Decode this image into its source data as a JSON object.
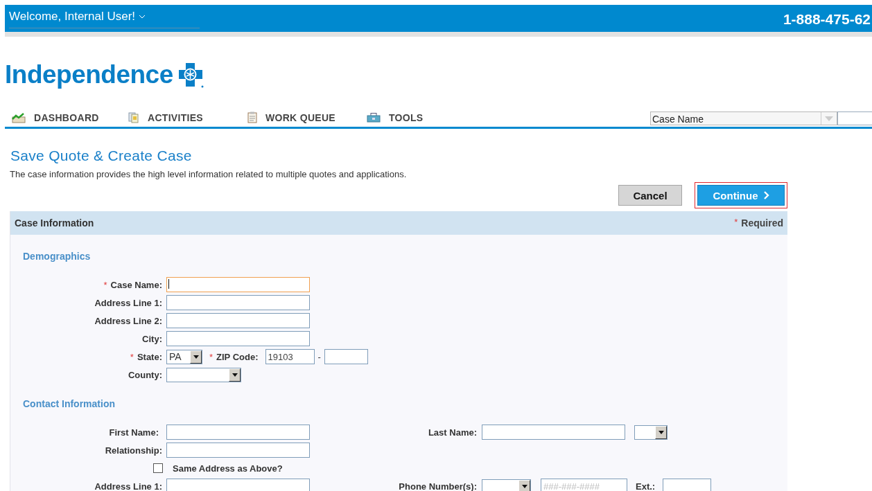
{
  "top_bar": {
    "greeting": "Welcome, Internal User!",
    "phone": "1-888-475-62"
  },
  "logo": {
    "text": "Independence"
  },
  "nav": {
    "items": [
      {
        "label": "DASHBOARD",
        "kind": "chart"
      },
      {
        "label": "ACTIVITIES",
        "kind": "documents"
      },
      {
        "label": "WORK QUEUE",
        "kind": "clipboard"
      },
      {
        "label": "TOOLS",
        "kind": "toolbox"
      }
    ],
    "search_by": "Case Name"
  },
  "page": {
    "title": "Save Quote & Create Case",
    "description": "The case information provides the high level information related to multiple quotes and applications."
  },
  "buttons": [
    {
      "label": "Cancel",
      "kind": "secondary",
      "highlighted": false
    },
    {
      "label": "Continue",
      "kind": "primary",
      "highlighted": true
    }
  ],
  "panel": {
    "title": "Case Information",
    "required_mark": "*",
    "required_label": "Required"
  },
  "sections": [
    {
      "title": "Demographics",
      "rows": [
        {
          "kind": "text",
          "mark": "*",
          "label": "Case Name:",
          "focused": true
        },
        {
          "kind": "text",
          "label": "Address Line 1:",
          "focused": false
        },
        {
          "kind": "text",
          "label": "Address Line 2:",
          "focused": false
        },
        {
          "kind": "text",
          "label": "City:",
          "focused": false
        },
        {
          "kind": "state_zip",
          "mark": "*",
          "label": "State:",
          "value": "PA",
          "zip_mark": "*",
          "zip_label": "ZIP Code:",
          "zip_value": "19103",
          "separator": "-"
        },
        {
          "kind": "select",
          "label": "County:"
        }
      ]
    },
    {
      "title": "Contact Information",
      "rows": [
        {
          "kind": "name_pair",
          "label": "First Name:",
          "right_label": "Last Name:"
        },
        {
          "kind": "text",
          "label": "Relationship:",
          "focused": false
        },
        {
          "kind": "checkbox",
          "label": "Same Address as Above?",
          "checked": false
        },
        {
          "kind": "phone_pair",
          "label": "Address Line 1:",
          "right_label": "Phone Number(s):",
          "phone_placeholder": "###-###-####",
          "ext_label": "Ext.:"
        }
      ]
    }
  ]
}
